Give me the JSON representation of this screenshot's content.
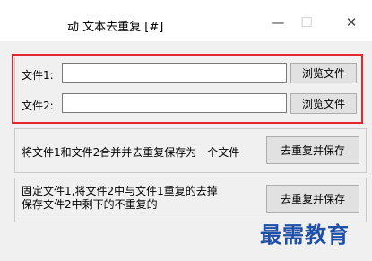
{
  "window": {
    "title": "动 文本去重复 [#]",
    "minimize_glyph": "—",
    "maximize_glyph": "☐",
    "close_glyph": "✕"
  },
  "file_group": {
    "file1_label": "文件1:",
    "file1_value": "",
    "file2_label": "文件2:",
    "file2_value": "",
    "browse1_label": "浏览文件",
    "browse2_label": "浏览文件"
  },
  "merge_group": {
    "description": "将文件1和文件2合并并去重复保存为一个文件",
    "button_label": "去重复并保存"
  },
  "fixed_group": {
    "description_line1": "固定文件1,将文件2中与文件1重复的去掉",
    "description_line2": "保存文件2中剩下的不重复的",
    "button_label": "去重复并保存"
  },
  "watermark": "最需教育",
  "colors": {
    "highlight_border": "#e8262f",
    "watermark": "#1f4fa8"
  }
}
